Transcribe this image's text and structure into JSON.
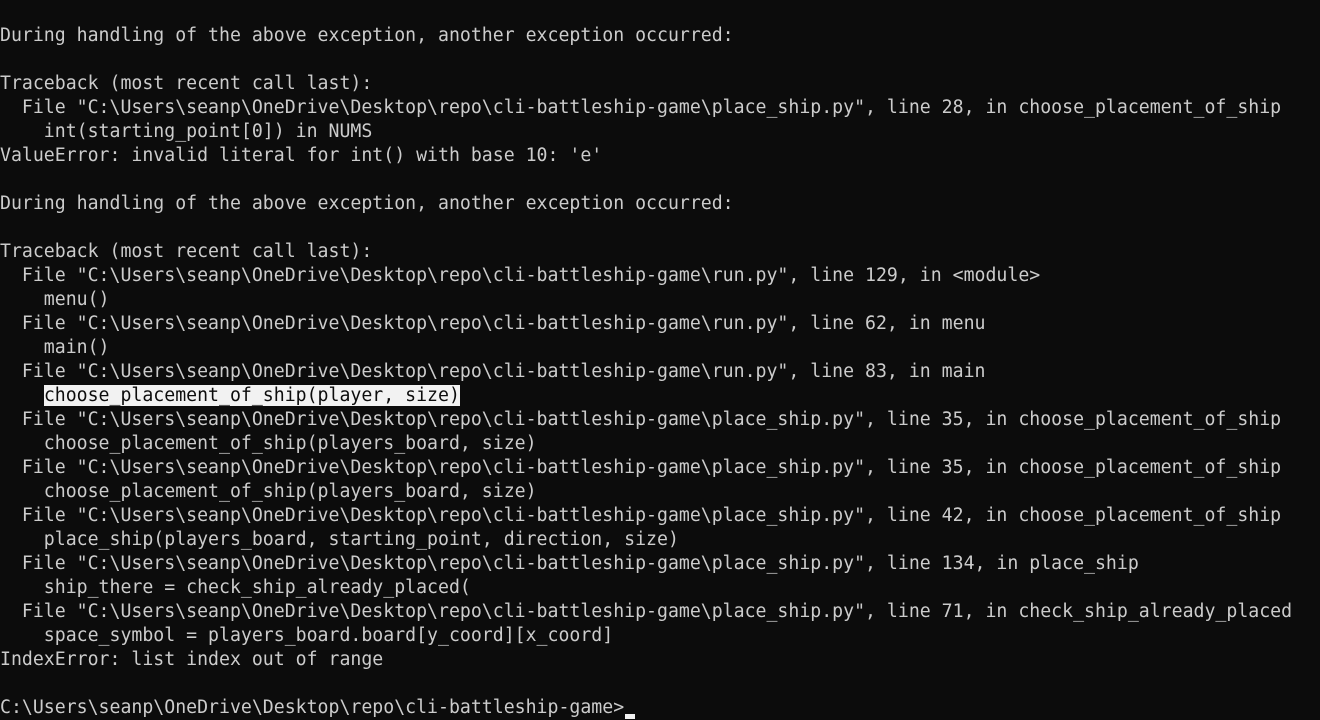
{
  "terminal": {
    "lines": [
      {
        "text": "During handling of the above exception, another exception occurred:"
      },
      {
        "text": ""
      },
      {
        "text": "Traceback (most recent call last):"
      },
      {
        "text": "  File \"C:\\Users\\seanp\\OneDrive\\Desktop\\repo\\cli-battleship-game\\place_ship.py\", line 28, in choose_placement_of_ship"
      },
      {
        "text": "    int(starting_point[0]) in NUMS"
      },
      {
        "text": "ValueError: invalid literal for int() with base 10: 'e'"
      },
      {
        "text": ""
      },
      {
        "text": "During handling of the above exception, another exception occurred:"
      },
      {
        "text": ""
      },
      {
        "text": "Traceback (most recent call last):"
      },
      {
        "text": "  File \"C:\\Users\\seanp\\OneDrive\\Desktop\\repo\\cli-battleship-game\\run.py\", line 129, in <module>"
      },
      {
        "text": "    menu()"
      },
      {
        "text": "  File \"C:\\Users\\seanp\\OneDrive\\Desktop\\repo\\cli-battleship-game\\run.py\", line 62, in menu"
      },
      {
        "text": "    main()"
      },
      {
        "text": "  File \"C:\\Users\\seanp\\OneDrive\\Desktop\\repo\\cli-battleship-game\\run.py\", line 83, in main"
      },
      {
        "indent": "    ",
        "text": "choose_placement_of_ship(player, size)",
        "selected": true
      },
      {
        "text": "  File \"C:\\Users\\seanp\\OneDrive\\Desktop\\repo\\cli-battleship-game\\place_ship.py\", line 35, in choose_placement_of_ship"
      },
      {
        "text": "    choose_placement_of_ship(players_board, size)"
      },
      {
        "text": "  File \"C:\\Users\\seanp\\OneDrive\\Desktop\\repo\\cli-battleship-game\\place_ship.py\", line 35, in choose_placement_of_ship"
      },
      {
        "text": "    choose_placement_of_ship(players_board, size)"
      },
      {
        "text": "  File \"C:\\Users\\seanp\\OneDrive\\Desktop\\repo\\cli-battleship-game\\place_ship.py\", line 42, in choose_placement_of_ship"
      },
      {
        "text": "    place_ship(players_board, starting_point, direction, size)"
      },
      {
        "text": "  File \"C:\\Users\\seanp\\OneDrive\\Desktop\\repo\\cli-battleship-game\\place_ship.py\", line 134, in place_ship"
      },
      {
        "text": "    ship_there = check_ship_already_placed("
      },
      {
        "text": "  File \"C:\\Users\\seanp\\OneDrive\\Desktop\\repo\\cli-battleship-game\\place_ship.py\", line 71, in check_ship_already_placed"
      },
      {
        "text": "    space_symbol = players_board.board[y_coord][x_coord]"
      },
      {
        "text": "IndexError: list index out of range"
      },
      {
        "text": ""
      }
    ],
    "prompt": "C:\\Users\\seanp\\OneDrive\\Desktop\\repo\\cli-battleship-game>"
  },
  "colors": {
    "background": "#0c0c0c",
    "foreground": "#cccccc",
    "selection_background": "#f2f2f2",
    "selection_foreground": "#0c0c0c",
    "cursor": "#f2f2f2"
  }
}
